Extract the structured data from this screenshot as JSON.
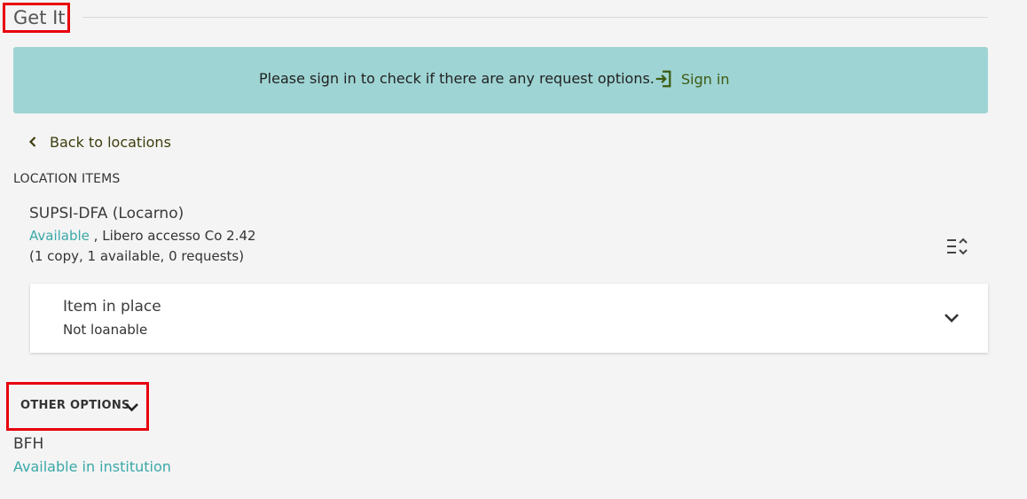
{
  "section": {
    "title": "Get It"
  },
  "banner": {
    "message": "Please sign in to check if there are any request options.",
    "signin_label": "Sign in",
    "signin_icon": "sign-in-icon",
    "background_color": "#9fd4d4"
  },
  "navigation": {
    "back_label": "Back to locations",
    "back_icon": "chevron-left-icon"
  },
  "location_items": {
    "heading": "LOCATION ITEMS",
    "location": {
      "name": "SUPSI-DFA (Locarno)",
      "availability": "Available",
      "shelf": " , Libero accesso Co 2.42",
      "counts": "(1 copy, 1 available, 0 requests)"
    },
    "sort_icon": "sort-list-icon",
    "items": [
      {
        "status": "Item in place",
        "policy": "Not loanable",
        "expand_icon": "chevron-down-icon"
      }
    ]
  },
  "other_options": {
    "label": "OTHER OPTIONS",
    "icon": "chevron-down-icon",
    "institutions": [
      {
        "name": "BFH",
        "availability": "Available in institution"
      }
    ]
  },
  "colors": {
    "highlight_border": "#e8000b",
    "available_text": "#3ba8a8",
    "link_text": "#3d5a12"
  }
}
